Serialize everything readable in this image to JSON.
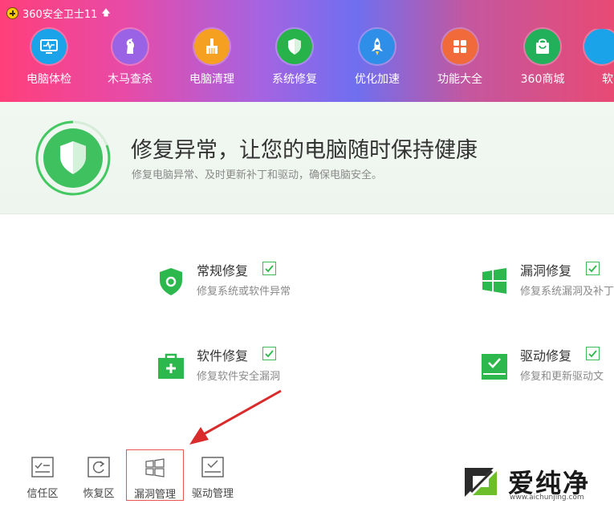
{
  "app": {
    "title": "360安全卫士11"
  },
  "nav": {
    "items": [
      {
        "label": "电脑体检",
        "icon": "monitor-pulse-icon",
        "color": "#1aa3e8"
      },
      {
        "label": "木马查杀",
        "icon": "horse-icon",
        "color": "#9a63e6"
      },
      {
        "label": "电脑清理",
        "icon": "broom-icon",
        "color": "#f5a020"
      },
      {
        "label": "系统修复",
        "icon": "shield-icon",
        "color": "#27b24a"
      },
      {
        "label": "优化加速",
        "icon": "rocket-icon",
        "color": "#2f8fe8"
      },
      {
        "label": "功能大全",
        "icon": "grid-icon",
        "color": "#f06a3c"
      },
      {
        "label": "360商城",
        "icon": "shopping-bag-icon",
        "color": "#23b05a"
      },
      {
        "label": "软",
        "icon": "app-icon",
        "color": "#1aa3e8"
      }
    ]
  },
  "hero": {
    "title": "修复异常，让您的电脑随时保持健康",
    "subtitle": "修复电脑异常、及时更新补丁和驱动，确保电脑安全。"
  },
  "options": [
    {
      "title": "常规修复",
      "desc": "修复系统或软件异常",
      "checked": true,
      "icon": "shield-icon"
    },
    {
      "title": "漏洞修复",
      "desc": "修复系统漏洞及补丁",
      "checked": true,
      "icon": "windows-icon"
    },
    {
      "title": "软件修复",
      "desc": "修复软件安全漏洞",
      "checked": true,
      "icon": "toolbox-icon"
    },
    {
      "title": "驱动修复",
      "desc": "修复和更新驱动文",
      "checked": true,
      "icon": "driver-icon"
    }
  ],
  "toolbar": {
    "items": [
      {
        "label": "信任区",
        "icon": "trust-list-icon"
      },
      {
        "label": "恢复区",
        "icon": "restore-icon"
      },
      {
        "label": "漏洞管理",
        "icon": "windows-icon",
        "selected": true
      },
      {
        "label": "驱动管理",
        "icon": "driver-icon"
      }
    ]
  },
  "watermark": {
    "text": "爱纯净",
    "url": "www.aichunjing.com"
  },
  "colors": {
    "accent_green": "#2cb84c",
    "arrow_red": "#d92b2b",
    "selected_border": "#e85555"
  }
}
